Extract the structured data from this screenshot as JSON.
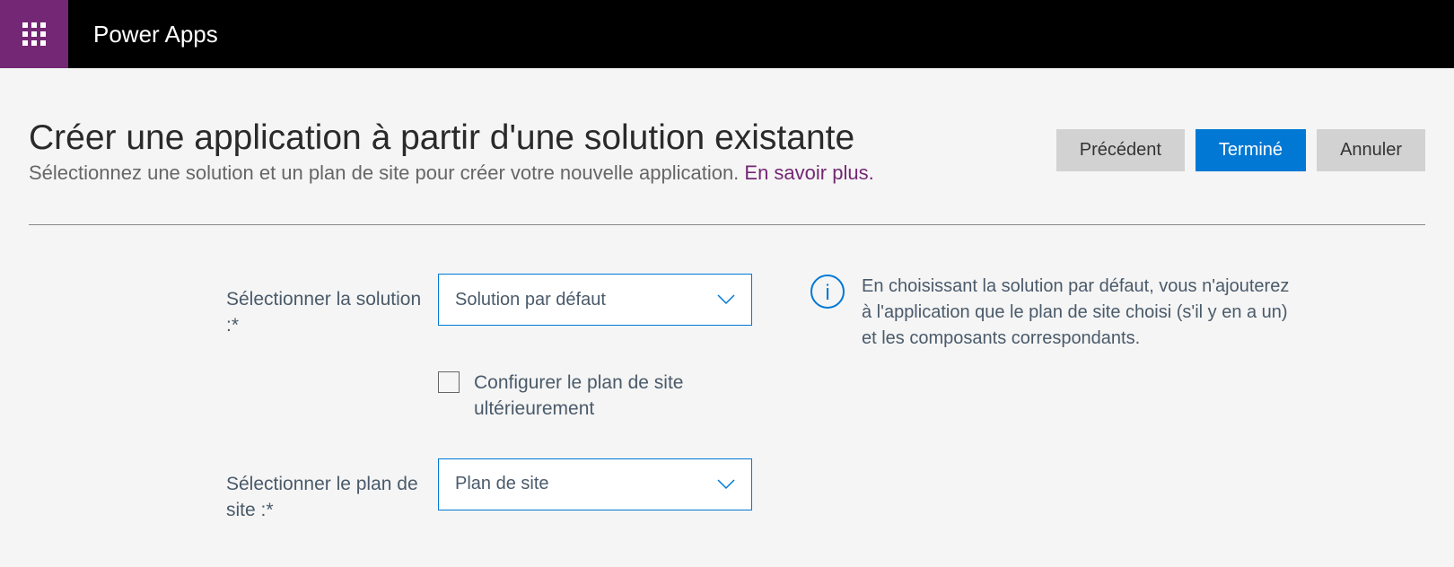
{
  "header": {
    "app_name": "Power Apps"
  },
  "page": {
    "title": "Créer une application à partir d'une solution existante",
    "subtitle": "Sélectionnez une solution et un plan de site pour créer votre nouvelle application. ",
    "learn_more": "En savoir plus."
  },
  "buttons": {
    "previous": "Précédent",
    "done": "Terminé",
    "cancel": "Annuler"
  },
  "form": {
    "select_solution_label": "Sélectionner la solution :*",
    "select_solution_value": "Solution par défaut",
    "configure_later_label": "Configurer le plan de site ultérieurement",
    "select_sitemap_label": "Sélectionner le plan de site :*",
    "select_sitemap_value": "Plan de site"
  },
  "info": {
    "text": "En choisissant la solution par défaut, vous n'ajouterez à l'application que le plan de site choisi (s'il y en a un) et les composants correspondants."
  }
}
